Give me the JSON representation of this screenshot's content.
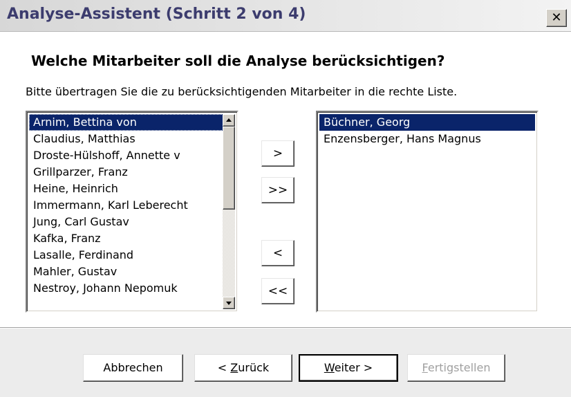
{
  "window": {
    "title": "Analyse-Assistent (Schritt 2 von 4)",
    "close_glyph": "✕"
  },
  "main": {
    "heading": "Welche Mitarbeiter soll die Analyse berücksichtigen?",
    "instruction": "Bitte übertragen Sie die zu berücksichtigenden Mitarbeiter in die rechte Liste."
  },
  "available_list": {
    "items": [
      "Arnim, Bettina von",
      "Claudius, Matthias",
      "Droste-Hülshoff, Annette v",
      "Grillparzer, Franz",
      "Heine, Heinrich",
      "Immermann, Karl Leberecht",
      "Jung, Carl Gustav",
      "Kafka, Franz",
      "Lasalle, Ferdinand",
      "Mahler, Gustav",
      "Nestroy, Johann Nepomuk"
    ],
    "selected_index": 0
  },
  "selected_list": {
    "items": [
      "Büchner, Georg",
      "Enzensberger, Hans Magnus"
    ],
    "selected_index": 0
  },
  "move_buttons": {
    "add": ">",
    "add_all": ">>",
    "remove": "<",
    "remove_all": "<<"
  },
  "footer": {
    "cancel": "Abbrechen",
    "back_prefix": "< ",
    "back_mnemonic": "Z",
    "back_rest": "urück",
    "next_mnemonic": "W",
    "next_rest": "eiter >",
    "finish_mnemonic": "F",
    "finish_rest": "ertigstellen"
  },
  "colors": {
    "selection": "#0a246a",
    "title_text": "#3c3c6e",
    "disabled_text": "#a0a0a0"
  }
}
